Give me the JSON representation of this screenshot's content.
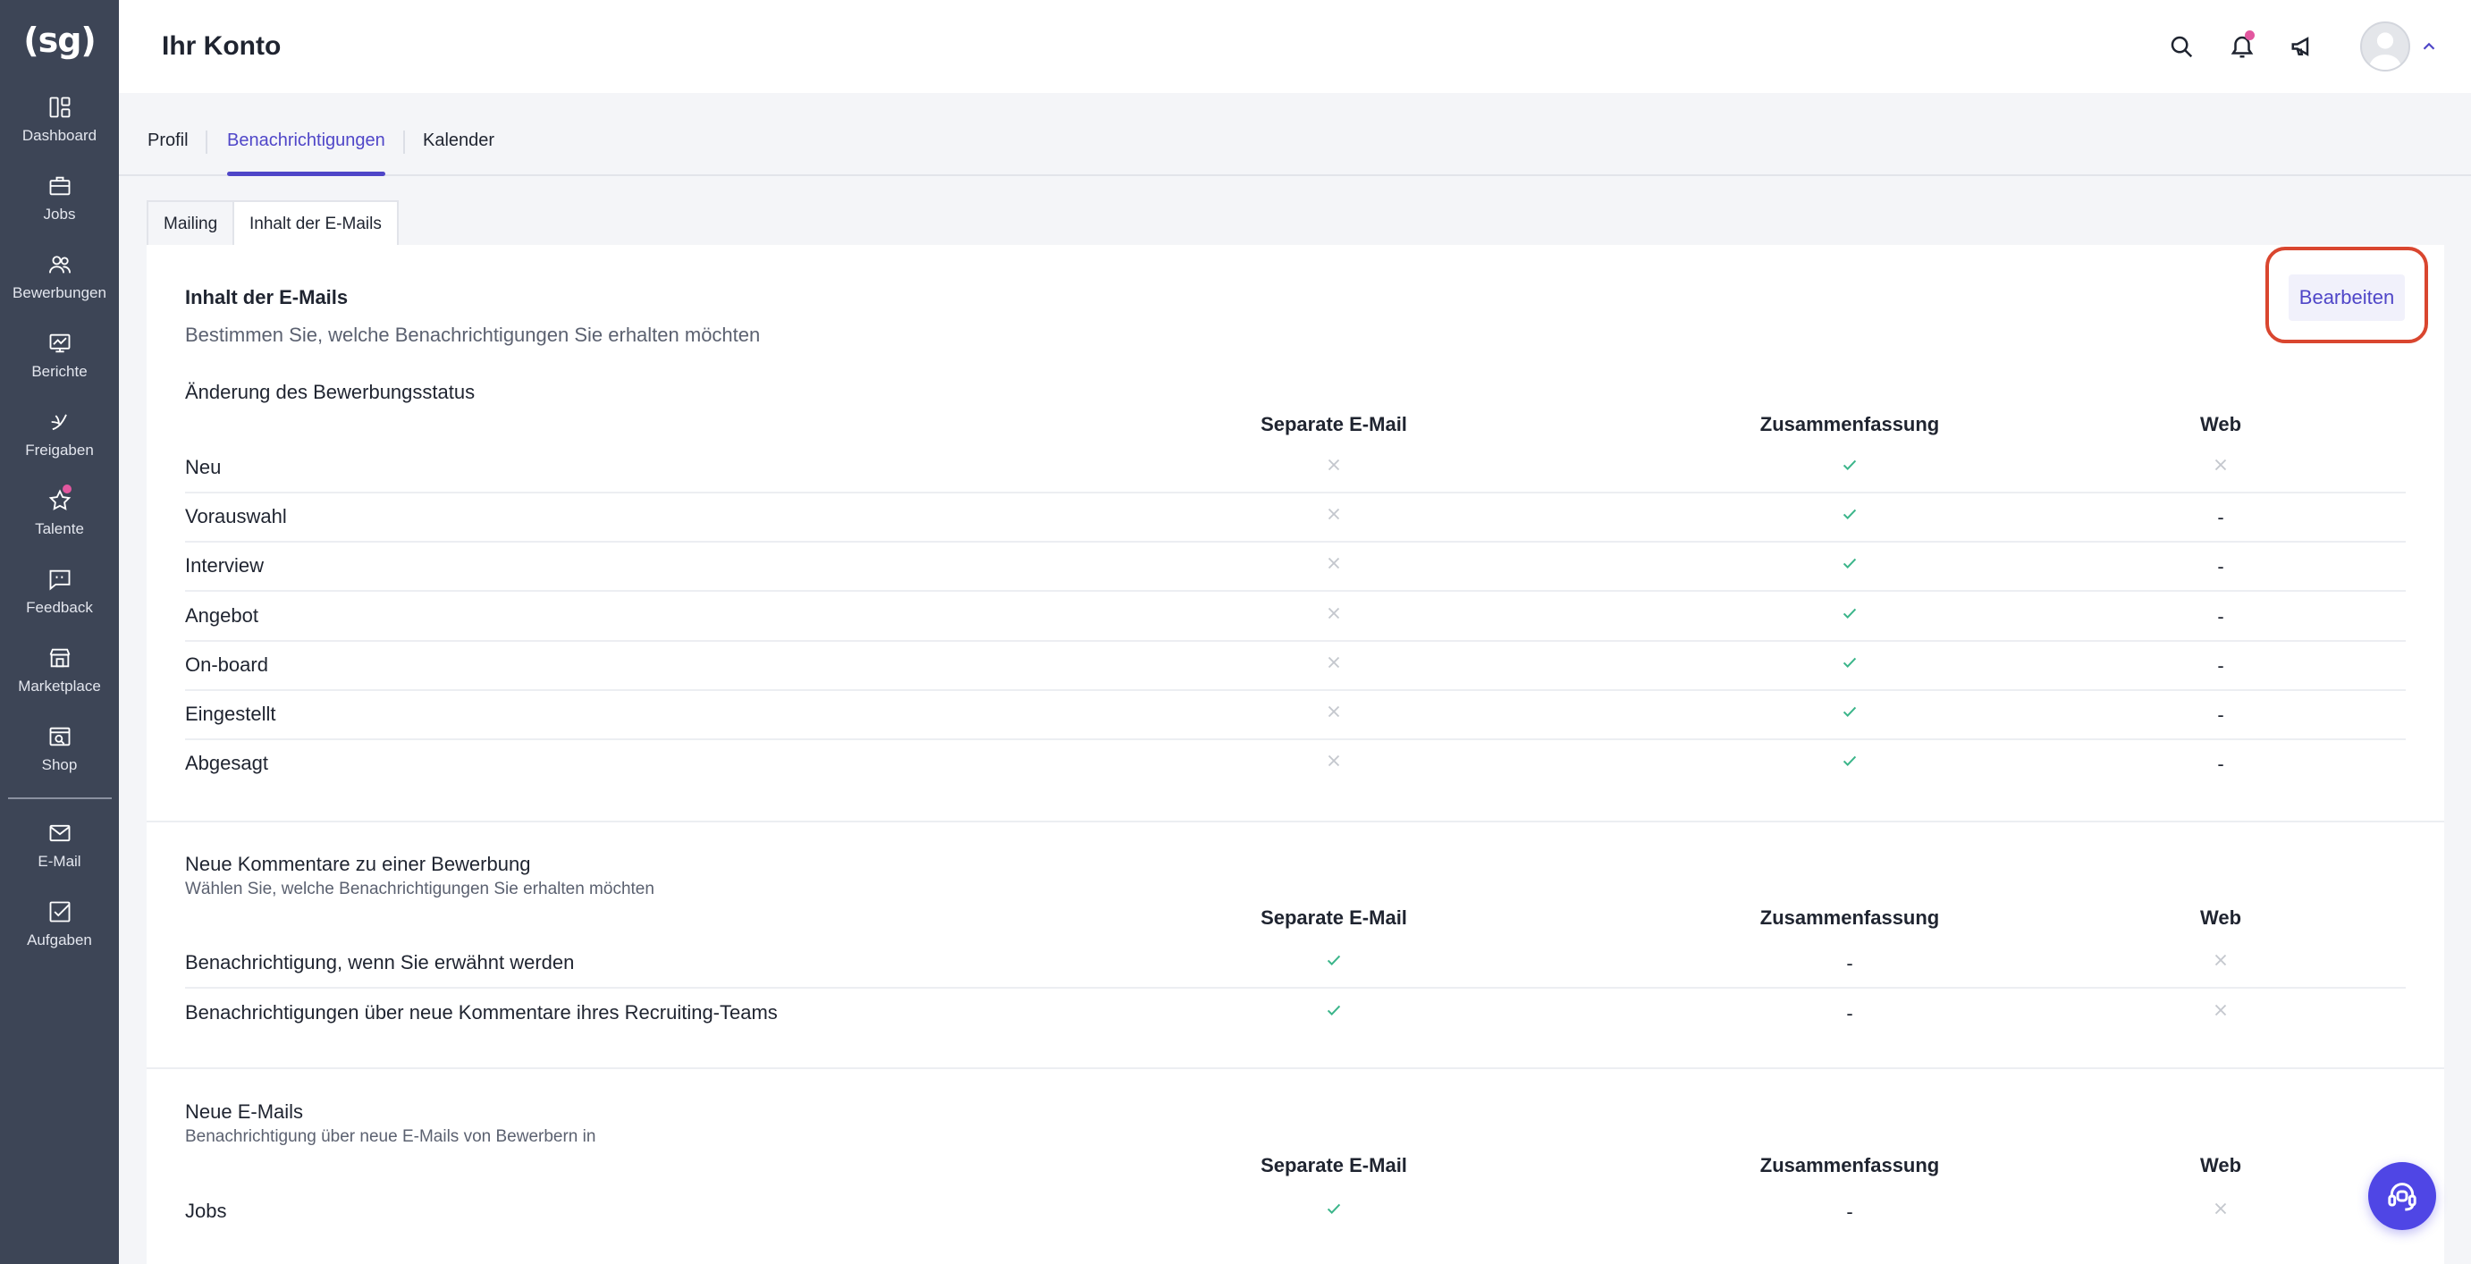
{
  "sidebar": {
    "logo": "(sg)",
    "items": [
      {
        "label": "Dashboard",
        "icon": "dashboard-icon"
      },
      {
        "label": "Jobs",
        "icon": "briefcase-icon"
      },
      {
        "label": "Bewerbungen",
        "icon": "users-icon"
      },
      {
        "label": "Berichte",
        "icon": "report-icon"
      },
      {
        "label": "Freigaben",
        "icon": "share-icon"
      },
      {
        "label": "Talente",
        "icon": "star-icon"
      },
      {
        "label": "Feedback",
        "icon": "feedback-icon"
      },
      {
        "label": "Marketplace",
        "icon": "store-icon"
      },
      {
        "label": "Shop",
        "icon": "shop-icon"
      },
      {
        "label": "E-Mail",
        "icon": "mail-icon"
      },
      {
        "label": "Aufgaben",
        "icon": "tasks-icon"
      }
    ]
  },
  "header": {
    "title": "Ihr Konto"
  },
  "tabs": [
    "Profil",
    "Benachrichtigungen",
    "Kalender"
  ],
  "subtabs": [
    "Mailing",
    "Inhalt der E-Mails"
  ],
  "card": {
    "title": "Inhalt der E-Mails",
    "subtitle": "Bestimmen Sie, welche Benachrichtigungen Sie erhalten möchten",
    "edit_label": "Bearbeiten"
  },
  "columns": [
    "Separate E-Mail",
    "Zusammenfassung",
    "Web"
  ],
  "sections": [
    {
      "title": "Änderung des Bewerbungsstatus",
      "subtitle": "",
      "rows": [
        {
          "label": "Neu",
          "values": [
            "x",
            "check",
            "x"
          ]
        },
        {
          "label": "Vorauswahl",
          "values": [
            "x",
            "check",
            "-"
          ]
        },
        {
          "label": "Interview",
          "values": [
            "x",
            "check",
            "-"
          ]
        },
        {
          "label": "Angebot",
          "values": [
            "x",
            "check",
            "-"
          ]
        },
        {
          "label": "On-board",
          "values": [
            "x",
            "check",
            "-"
          ]
        },
        {
          "label": "Eingestellt",
          "values": [
            "x",
            "check",
            "-"
          ]
        },
        {
          "label": "Abgesagt",
          "values": [
            "x",
            "check",
            "-"
          ]
        }
      ]
    },
    {
      "title": "Neue Kommentare zu einer Bewerbung",
      "subtitle": "Wählen Sie, welche Benachrichtigungen Sie erhalten möchten",
      "rows": [
        {
          "label": "Benachrichtigung, wenn Sie erwähnt werden",
          "values": [
            "check",
            "-",
            "x"
          ]
        },
        {
          "label": "Benachrichtigungen über neue Kommentare ihres Recruiting-Teams",
          "values": [
            "check",
            "-",
            "x"
          ]
        }
      ]
    },
    {
      "title": "Neue E-Mails",
      "subtitle": "Benachrichtigung über neue E-Mails von Bewerbern in",
      "rows": [
        {
          "label": "Jobs",
          "values": [
            "check",
            "-",
            "x"
          ]
        }
      ]
    }
  ],
  "colors": {
    "accent": "#4f46c8",
    "check": "#3bb58a",
    "cross": "#c4c7ce",
    "sidebar": "#3d4556",
    "highlight": "#d9462f"
  }
}
